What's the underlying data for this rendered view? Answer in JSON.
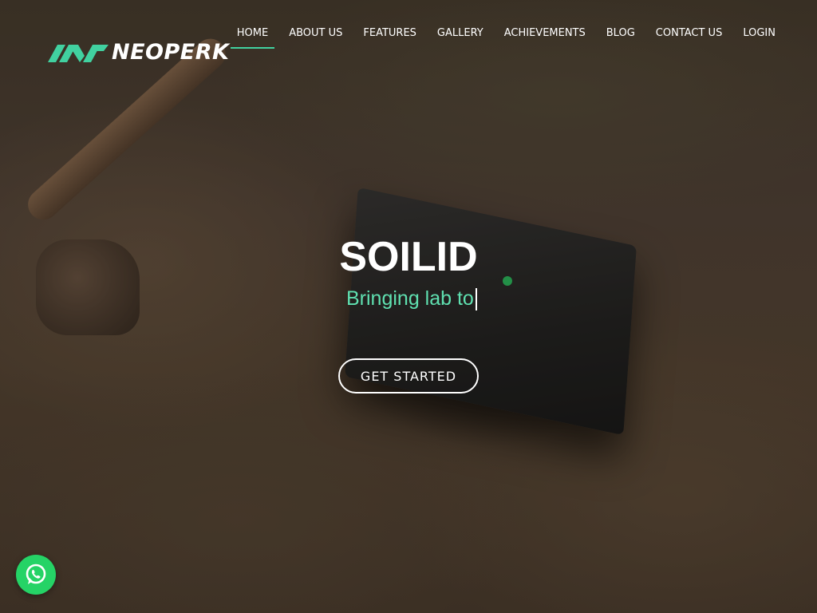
{
  "brand": {
    "name": "NEOPERK",
    "logo_icon": "neoperk-mountain-logo",
    "accent_color": "#41d1a0"
  },
  "nav": {
    "items": [
      {
        "label": "HOME",
        "active": true
      },
      {
        "label": "ABOUT US",
        "active": false
      },
      {
        "label": "FEATURES",
        "active": false
      },
      {
        "label": "GALLERY",
        "active": false
      },
      {
        "label": "ACHIEVEMENTS",
        "active": false
      },
      {
        "label": "BLOG",
        "active": false
      },
      {
        "label": "CONTACT US",
        "active": false
      },
      {
        "label": "LOGIN",
        "active": false
      }
    ]
  },
  "hero": {
    "title": "SOILID",
    "subtitle": "Bringing lab to",
    "subtitle_color": "#5fe0b0",
    "cta_label": "GET STARTED"
  },
  "floating": {
    "whatsapp_icon": "whatsapp-icon",
    "whatsapp_color": "#25d366"
  }
}
